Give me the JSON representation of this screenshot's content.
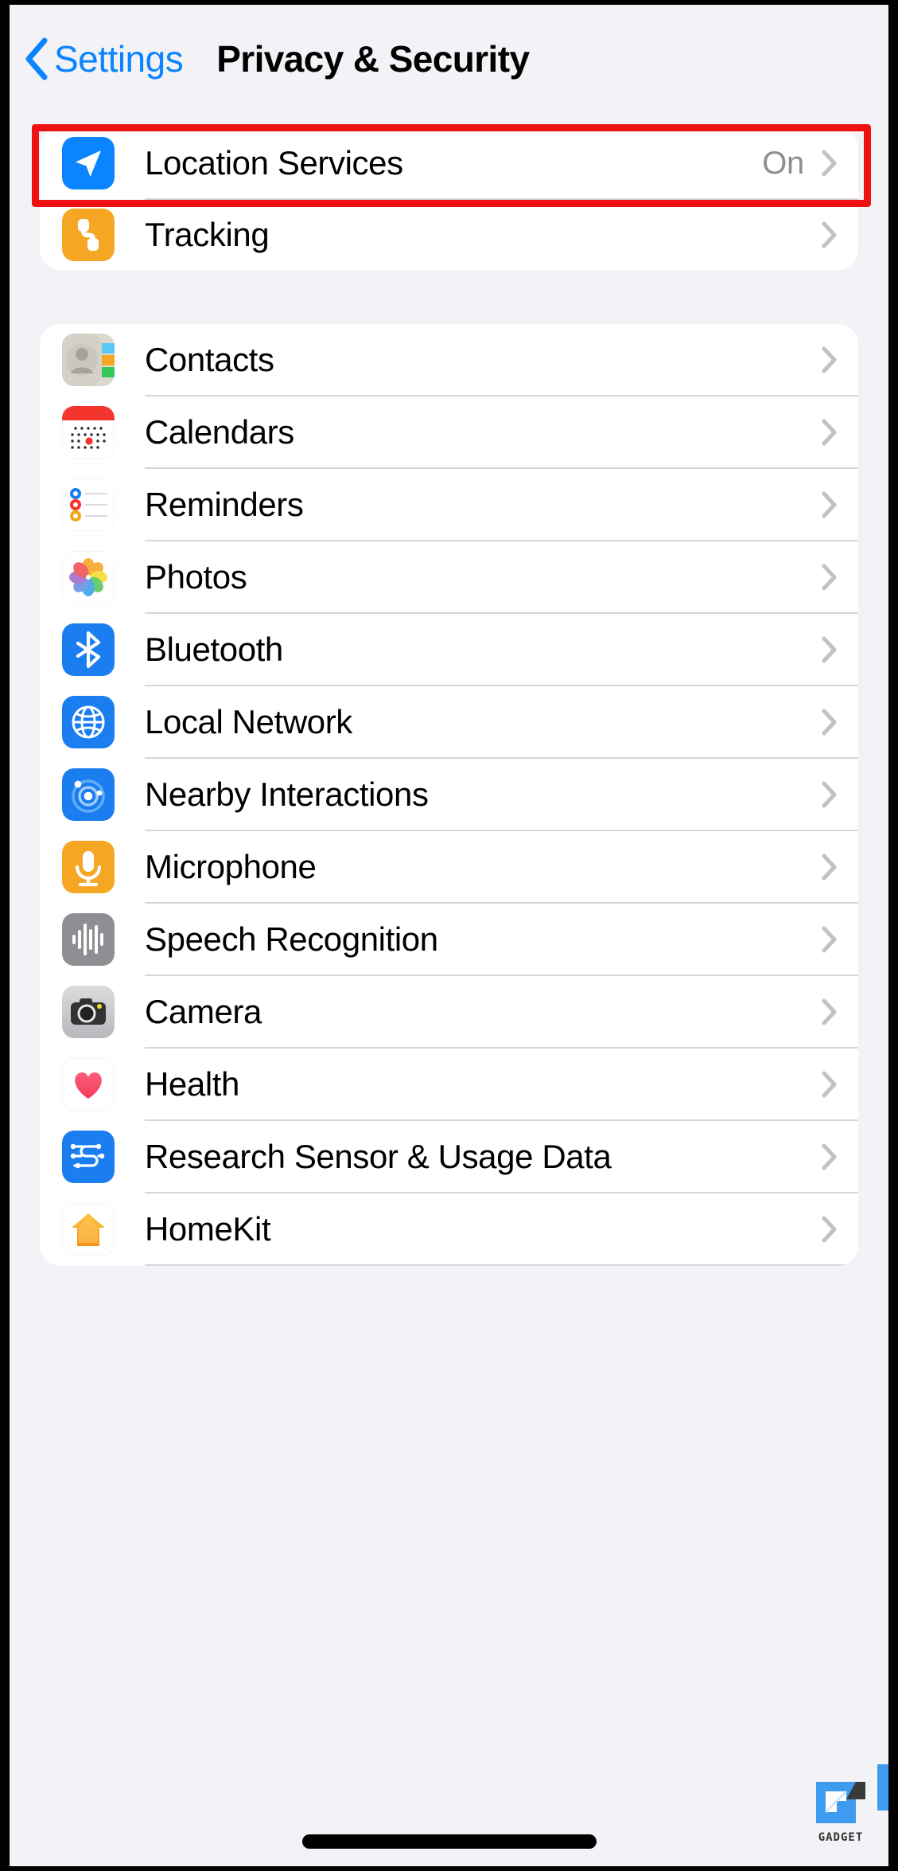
{
  "navbar": {
    "back_label": "Settings",
    "back_icon": "chevron-left-icon",
    "title": "Privacy & Security"
  },
  "colors": {
    "accent_blue": "#0a84ff",
    "highlight_red": "#ee1111",
    "page_background": "#f2f2f7",
    "card_background": "#ffffff",
    "separator": "#d6d6da",
    "secondary_text": "#8e8e93"
  },
  "highlight": {
    "target_row": "Location Services",
    "color": "#ee1111"
  },
  "sections": [
    {
      "id": "primary",
      "rows": [
        {
          "label": "Location Services",
          "value": "On",
          "icon": "location-arrow-icon",
          "icon_color": "#0a84ff",
          "chevron": "chevron-right-icon",
          "highlighted": true
        },
        {
          "label": "Tracking",
          "value": "",
          "icon": "tracking-icon",
          "icon_color": "#f5a623",
          "chevron": "chevron-right-icon",
          "highlighted": false
        }
      ]
    },
    {
      "id": "apps",
      "rows": [
        {
          "label": "Contacts",
          "value": "",
          "icon": "contacts-icon",
          "icon_color": "#d4d1c8",
          "chevron": "chevron-right-icon"
        },
        {
          "label": "Calendars",
          "value": "",
          "icon": "calendar-icon",
          "icon_color": "#ffffff",
          "chevron": "chevron-right-icon"
        },
        {
          "label": "Reminders",
          "value": "",
          "icon": "reminders-icon",
          "icon_color": "#ffffff",
          "chevron": "chevron-right-icon"
        },
        {
          "label": "Photos",
          "value": "",
          "icon": "photos-icon",
          "icon_color": "#ffffff",
          "chevron": "chevron-right-icon"
        },
        {
          "label": "Bluetooth",
          "value": "",
          "icon": "bluetooth-icon",
          "icon_color": "#0a84ff",
          "chevron": "chevron-right-icon"
        },
        {
          "label": "Local Network",
          "value": "",
          "icon": "globe-icon",
          "icon_color": "#0a84ff",
          "chevron": "chevron-right-icon"
        },
        {
          "label": "Nearby Interactions",
          "value": "",
          "icon": "nearby-interactions-icon",
          "icon_color": "#0a84ff",
          "chevron": "chevron-right-icon"
        },
        {
          "label": "Microphone",
          "value": "",
          "icon": "microphone-icon",
          "icon_color": "#f5a623",
          "chevron": "chevron-right-icon"
        },
        {
          "label": "Speech Recognition",
          "value": "",
          "icon": "waveform-icon",
          "icon_color": "#8e8e93",
          "chevron": "chevron-right-icon"
        },
        {
          "label": "Camera",
          "value": "",
          "icon": "camera-icon",
          "icon_color": "#c6c6ca",
          "chevron": "chevron-right-icon"
        },
        {
          "label": "Health",
          "value": "",
          "icon": "heart-icon",
          "icon_color": "#ffffff",
          "chevron": "chevron-right-icon"
        },
        {
          "label": "Research Sensor & Usage Data",
          "value": "",
          "icon": "research-sensor-icon",
          "icon_color": "#0a84ff",
          "chevron": "chevron-right-icon"
        },
        {
          "label": "HomeKit",
          "value": "",
          "icon": "homekit-icon",
          "icon_color": "#ffffff",
          "chevron": "chevron-right-icon"
        }
      ]
    }
  ],
  "watermark": {
    "label": "GADGET"
  }
}
